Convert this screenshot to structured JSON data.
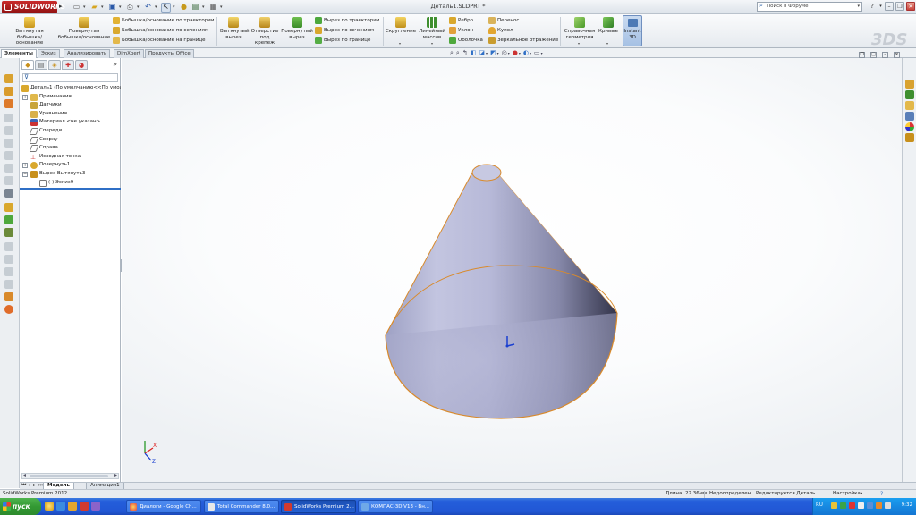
{
  "app": {
    "logo": "SOLIDWORKS",
    "document_title": "Деталь1.SLDPRT *",
    "search_placeholder": "Поиск в Форуме"
  },
  "commands": {
    "extruded_boss": "Вытянутая бобышка/основание",
    "revolved_boss": "Повернутая бобышка/основание",
    "swept_boss": "Бобышка/основание по траектории",
    "lofted_boss": "Бобышка/основание по сечениям",
    "boundary_boss": "Бобышка/основание на границе",
    "extruded_cut": "Вытянутый вырез",
    "hole_wizard": "Отверстие под крепеж",
    "revolved_cut": "Повернутый вырез",
    "swept_cut": "Вырез по траектории",
    "lofted_cut": "Вырез по сечениям",
    "boundary_cut": "Вырез по границе",
    "fillet": "Скругление",
    "linear_pattern": "Линейный массив",
    "rib": "Ребро",
    "draft": "Уклон",
    "shell": "Оболочка",
    "wrap": "Перенос",
    "dome": "Купол",
    "mirror": "Зеркальное отражение",
    "ref_geometry": "Справочная геометрия",
    "curves": "Кривые",
    "instant3d": "Instant 3D"
  },
  "tabs": [
    "Элементы",
    "Эскиз",
    "Анализировать",
    "DimXpert",
    "Продукты Office"
  ],
  "feature_tree": {
    "root": "Деталь1  (По умолчанию<<По умолчанию>)",
    "items": [
      {
        "label": "Примечания",
        "expandable": true
      },
      {
        "label": "Датчики",
        "expandable": false
      },
      {
        "label": "Уравнения",
        "expandable": false
      },
      {
        "label": "Материал <не указан>",
        "expandable": false
      },
      {
        "label": "Спереди",
        "expandable": false
      },
      {
        "label": "Сверху",
        "expandable": false
      },
      {
        "label": "Справа",
        "expandable": false
      },
      {
        "label": "Исходная точка",
        "expandable": false
      },
      {
        "label": "Повернуть1",
        "expandable": true
      },
      {
        "label": "Вырез-Вытянуть3",
        "expandable": true,
        "expanded": true
      },
      {
        "label": "(-) Эскиз9",
        "expandable": false
      }
    ]
  },
  "bottom_tabs": [
    "Модель",
    "Анимация1"
  ],
  "status": {
    "product": "SolidWorks Premium 2012",
    "length": "Длина: 22.36мм",
    "state": "Недоопределен",
    "editing": "Редактируется Деталь",
    "settings": "Настройка"
  },
  "taskbar": {
    "start": "пуск",
    "windows": [
      {
        "label": "Диалоги - Google Ch...",
        "active": false
      },
      {
        "label": "Total Commander 8.0...",
        "active": false
      },
      {
        "label": "SolidWorks Premium 2...",
        "active": true
      },
      {
        "label": "КОМПАС-3D V13 - Вн...",
        "active": false
      }
    ],
    "lang": "RU",
    "clock": "9:32"
  },
  "colors": {
    "accent": "#2f6fc6",
    "cone_edge": "#d98a2b",
    "taskbar": "#245edb",
    "start": "#339933"
  }
}
